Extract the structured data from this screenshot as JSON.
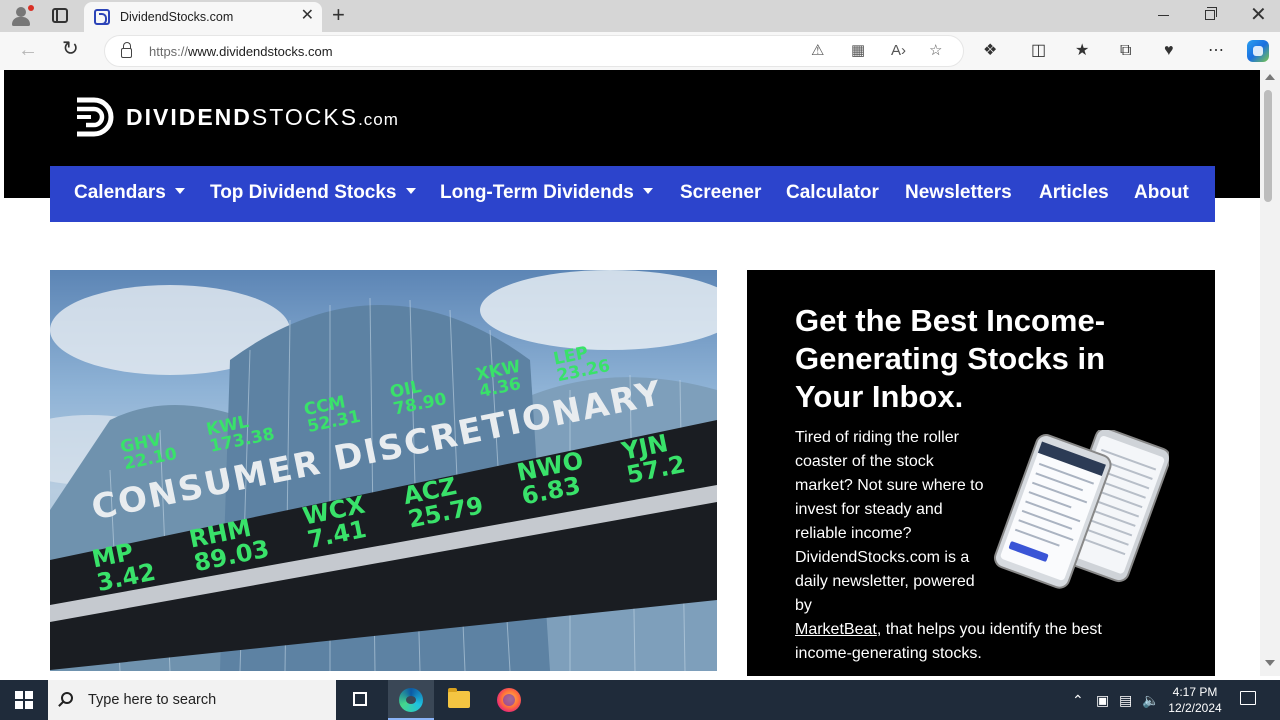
{
  "browser": {
    "tab_title": "DividendStocks.com",
    "tab_close": "✕",
    "new_tab": "+",
    "url_scheme": "https://",
    "url_host": "www.dividendstocks.com",
    "back": "←",
    "reload": "↻",
    "window_close": "✕"
  },
  "site": {
    "logo_bold": "DIVIDEND",
    "logo_light": "STOCKS",
    "logo_com": ".com",
    "nav": [
      {
        "label": "Calendars",
        "has_dropdown": true
      },
      {
        "label": "Top Dividend Stocks",
        "has_dropdown": true
      },
      {
        "label": "Long-Term Dividends",
        "has_dropdown": true
      },
      {
        "label": "Screener",
        "has_dropdown": false
      },
      {
        "label": "Calculator",
        "has_dropdown": false
      },
      {
        "label": "Newsletters",
        "has_dropdown": false
      },
      {
        "label": "Articles",
        "has_dropdown": false
      },
      {
        "label": "About",
        "has_dropdown": false
      }
    ],
    "hero": {
      "board_title": "CONSUMER DISCRETIONARY",
      "top_row": [
        {
          "sym": "GHV",
          "val": "22.10"
        },
        {
          "sym": "KWL",
          "val": "173.38"
        },
        {
          "sym": "CCM",
          "val": "52.31"
        },
        {
          "sym": "OIL",
          "val": "78.90"
        },
        {
          "sym": "XKW",
          "val": "4.36"
        },
        {
          "sym": "LEP",
          "val": "23.26"
        }
      ],
      "bottom_row": [
        {
          "sym": "MP",
          "val": "3.42"
        },
        {
          "sym": "RHM",
          "val": "89.03"
        },
        {
          "sym": "WCX",
          "val": "7.41"
        },
        {
          "sym": "ACZ",
          "val": "25.79"
        },
        {
          "sym": "NWO",
          "val": "6.83"
        },
        {
          "sym": "YJN",
          "val": "57.2"
        }
      ]
    },
    "promo": {
      "title": "Get the Best Income-Generating Stocks in Your Inbox.",
      "body_part1": "Tired of riding the roller coaster of the stock market? Not sure where to invest for steady and reliable income? DividendStocks.com is a daily newsletter, powered by",
      "link": "MarketBeat",
      "body_part2": ", that helps you identify the best income-generating stocks."
    }
  },
  "taskbar": {
    "search_placeholder": "Type here to search",
    "time": "4:17 PM",
    "date": "12/2/2024"
  },
  "colors": {
    "nav_blue": "#2c44cc",
    "header_black": "#000000",
    "ticker_green": "#39e26a"
  }
}
